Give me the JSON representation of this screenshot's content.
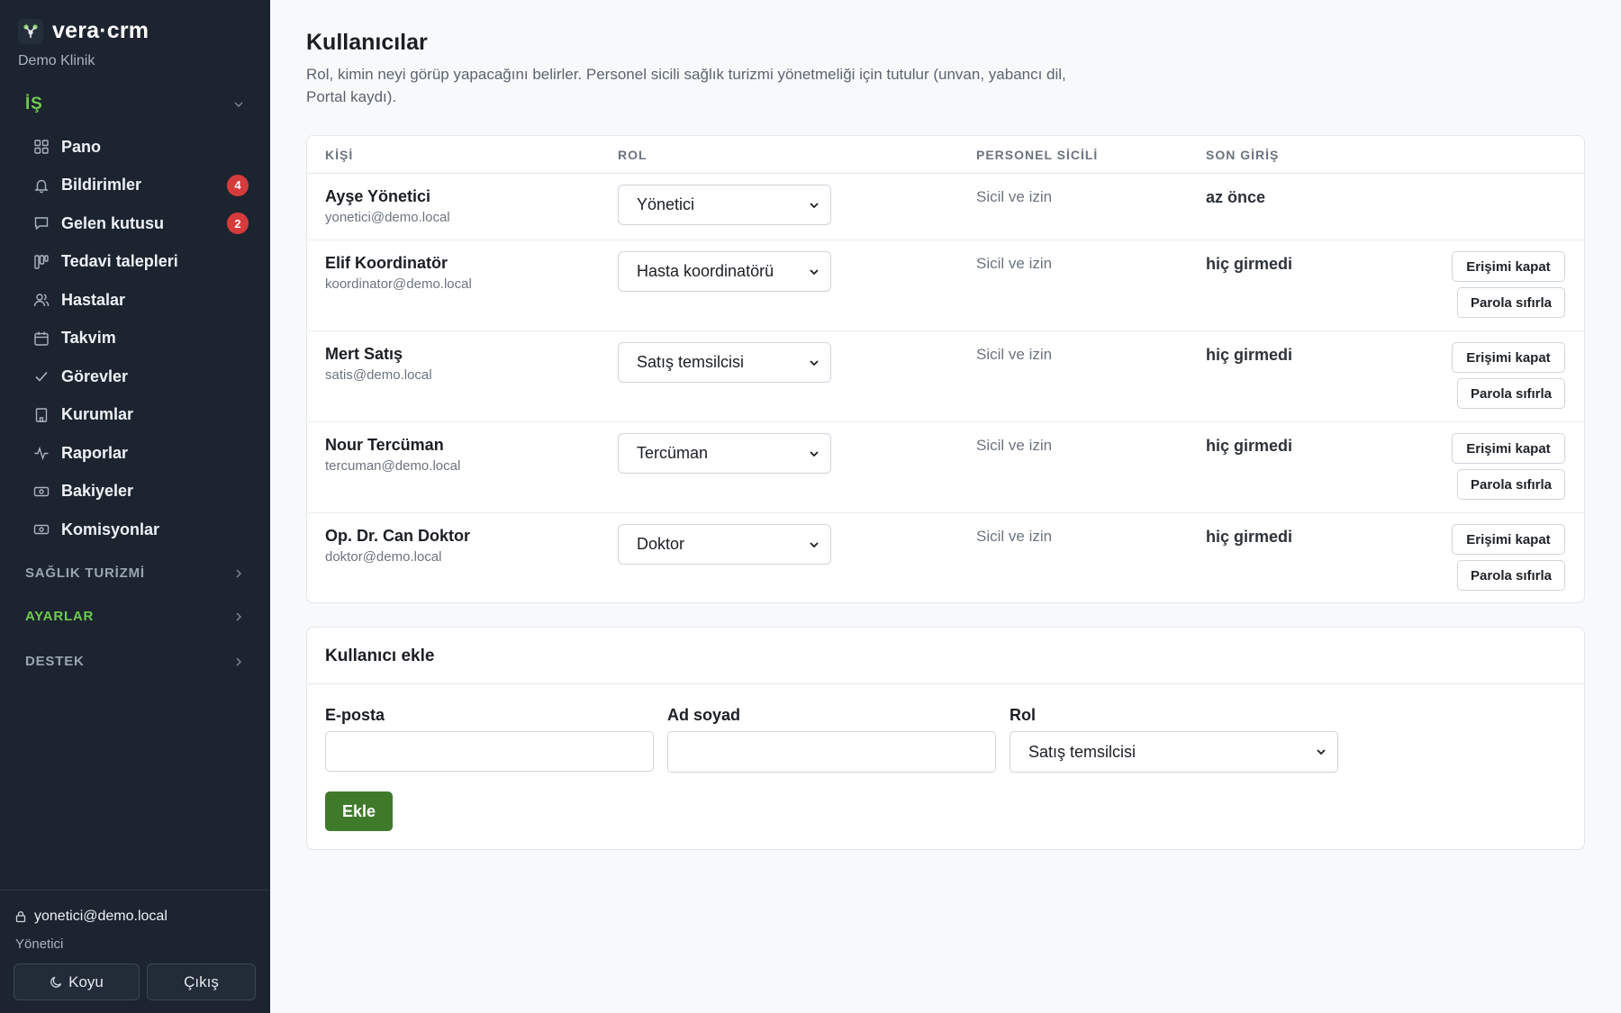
{
  "app": {
    "brand": "vera·crm",
    "tenant": "Demo Klinik",
    "accent_color": "#6fcb4f",
    "primary_button_color": "#3f7a2b",
    "badge_color": "#d63b3b"
  },
  "sidebar": {
    "group_is": "İŞ",
    "items": [
      {
        "label": "Pano",
        "icon": "grid-icon"
      },
      {
        "label": "Bildirimler",
        "icon": "bell-icon",
        "badge": "4"
      },
      {
        "label": "Gelen kutusu",
        "icon": "chat-icon",
        "badge": "2"
      },
      {
        "label": "Tedavi talepleri",
        "icon": "kanban-icon"
      },
      {
        "label": "Hastalar",
        "icon": "users-icon"
      },
      {
        "label": "Takvim",
        "icon": "calendar-icon"
      },
      {
        "label": "Görevler",
        "icon": "check-icon"
      },
      {
        "label": "Kurumlar",
        "icon": "building-icon"
      },
      {
        "label": "Raporlar",
        "icon": "activity-icon"
      },
      {
        "label": "Bakiyeler",
        "icon": "banknote-icon"
      },
      {
        "label": "Komisyonlar",
        "icon": "banknote-icon"
      }
    ],
    "groups": [
      "SAĞLIK TURİZMİ",
      "AYARLAR",
      "DESTEK"
    ],
    "footer": {
      "email": "yonetici@demo.local",
      "role": "Yönetici",
      "theme_label": "Koyu",
      "logout_label": "Çıkış"
    }
  },
  "page": {
    "title": "Kullanıcılar",
    "description": "Rol, kimin neyi görüp yapacağını belirler. Personel sicili sağlık turizmi yönetmeliği için tutulur (unvan, yabancı dil, Portal kaydı)."
  },
  "table": {
    "headers": [
      "KİŞİ",
      "ROL",
      "PERSONEL SİCİLİ",
      "SON GİRİŞ"
    ],
    "rows": [
      {
        "name": "Ayşe Yönetici",
        "email": "yonetici@demo.local",
        "role": "Yönetici",
        "registry": "Sicil ve izin",
        "last_login": "az önce"
      },
      {
        "name": "Elif Koordinatör",
        "email": "koordinator@demo.local",
        "role": "Hasta koordinatörü",
        "registry": "Sicil ve izin",
        "last_login": "hiç girmedi"
      },
      {
        "name": "Mert Satış",
        "email": "satis@demo.local",
        "role": "Satış temsilcisi",
        "registry": "Sicil ve izin",
        "last_login": "hiç girmedi"
      },
      {
        "name": "Nour Tercüman",
        "email": "tercuman@demo.local",
        "role": "Tercüman",
        "registry": "Sicil ve izin",
        "last_login": "hiç girmedi"
      },
      {
        "name": "Op. Dr. Can Doktor",
        "email": "doktor@demo.local",
        "role": "Doktor",
        "registry": "Sicil ve izin",
        "last_login": "hiç girmedi"
      }
    ],
    "revoke_label": "Erişimi kapat",
    "reset_label": "Parola sıfırla"
  },
  "add_user": {
    "title": "Kullanıcı ekle",
    "email_label": "E-posta",
    "email_value": "",
    "name_label": "Ad soyad",
    "name_value": "",
    "role_label": "Rol",
    "role_value": "Satış temsilcisi",
    "submit_label": "Ekle"
  }
}
